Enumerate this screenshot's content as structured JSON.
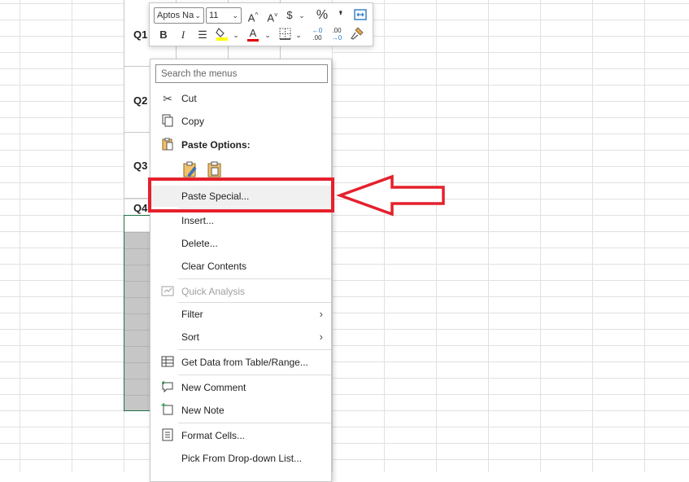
{
  "sheet": {
    "row_labels": [
      "Q1",
      "Q2",
      "Q3",
      "Q4"
    ],
    "accent_color": "#217346"
  },
  "mini_toolbar": {
    "font_name": "Aptos Na",
    "font_size": "11",
    "grow_font": "A^",
    "shrink_font": "A˅",
    "currency": "$",
    "percent": "%",
    "comma": "❜",
    "bold": "B",
    "italic": "I",
    "font_color_letter": "A",
    "highlight_color": "#ffff00",
    "font_color": "#e00000",
    "increase_decimal": ".00",
    "decrease_decimal": ".00"
  },
  "context_menu": {
    "search_placeholder": "Search the menus",
    "items": [
      {
        "label": "Cut",
        "icon": "scissors-icon"
      },
      {
        "label": "Copy",
        "icon": "copy-icon"
      },
      {
        "label": "Paste Options:",
        "icon": "clipboard-icon"
      },
      {
        "label": "Paste Special...",
        "icon": ""
      },
      {
        "label": "Insert...",
        "icon": ""
      },
      {
        "label": "Delete...",
        "icon": ""
      },
      {
        "label": "Clear Contents",
        "icon": ""
      },
      {
        "label": "Quick Analysis",
        "icon": "quick-analysis-icon"
      },
      {
        "label": "Filter",
        "icon": ""
      },
      {
        "label": "Sort",
        "icon": ""
      },
      {
        "label": "Get Data from Table/Range...",
        "icon": "table-icon"
      },
      {
        "label": "New Comment",
        "icon": "comment-icon"
      },
      {
        "label": "New Note",
        "icon": "note-icon"
      },
      {
        "label": "Format Cells...",
        "icon": "format-cells-icon"
      },
      {
        "label": "Pick From Drop-down List...",
        "icon": ""
      }
    ]
  },
  "annotation": {
    "highlight_color": "#e5202c"
  }
}
